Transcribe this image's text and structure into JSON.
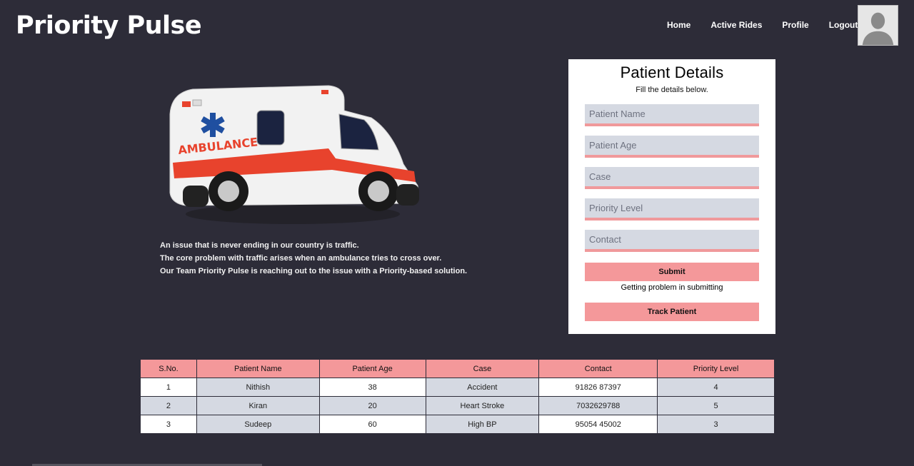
{
  "header": {
    "brand": "Priority Pulse",
    "nav": [
      "Home",
      "Active Rides",
      "Profile",
      "Logout"
    ]
  },
  "hero": {
    "vehicle_label": "AMBULANCE",
    "lines": [
      "An issue that is never ending in our country is traffic.",
      "The core problem with traffic arises when an ambulance tries to cross over.",
      "Our Team Priority Pulse is reaching out to the issue with a Priority-based solution."
    ]
  },
  "form": {
    "title": "Patient Details",
    "subtitle": "Fill the details below.",
    "placeholders": {
      "name": "Patient Name",
      "age": "Patient Age",
      "case": "Case",
      "priority": "Priority Level",
      "contact": "Contact"
    },
    "submit_label": "Submit",
    "problem_text": "Getting problem in submitting",
    "track_label": "Track Patient"
  },
  "table": {
    "headers": [
      "S.No.",
      "Patient Name",
      "Patient Age",
      "Case",
      "Contact",
      "Priority Level"
    ],
    "rows": [
      [
        "1",
        "Nithish",
        "38",
        "Accident",
        "91826 87397",
        "4"
      ],
      [
        "2",
        "Kiran",
        "20",
        "Heart Stroke",
        "7032629788",
        "5"
      ],
      [
        "3",
        "Sudeep",
        "60",
        "High BP",
        "95054 45002",
        "3"
      ]
    ]
  },
  "colors": {
    "background": "#2d2c38",
    "accent": "#f4989a",
    "field_bg": "#d5d9e2"
  }
}
